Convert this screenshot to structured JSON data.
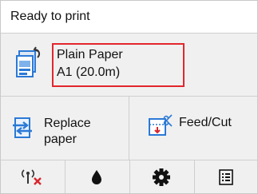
{
  "status": {
    "text": "Ready to print"
  },
  "paper": {
    "icon": "paper-settings-icon",
    "type": "Plain Paper",
    "size": "A1 (20.0m)",
    "highlight_color": "#e2262d"
  },
  "actions": {
    "replace": {
      "label": "Replace paper",
      "icon": "replace-paper-icon"
    },
    "feed": {
      "label": "Feed/Cut",
      "icon": "feed-cut-icon"
    }
  },
  "bottom": [
    {
      "icon": "wireless-disconnected-icon"
    },
    {
      "icon": "ink-drop-icon"
    },
    {
      "icon": "gear-icon"
    },
    {
      "icon": "menu-list-icon"
    }
  ],
  "colors": {
    "accent_blue": "#2b79d6",
    "alert_red": "#d7262c"
  }
}
